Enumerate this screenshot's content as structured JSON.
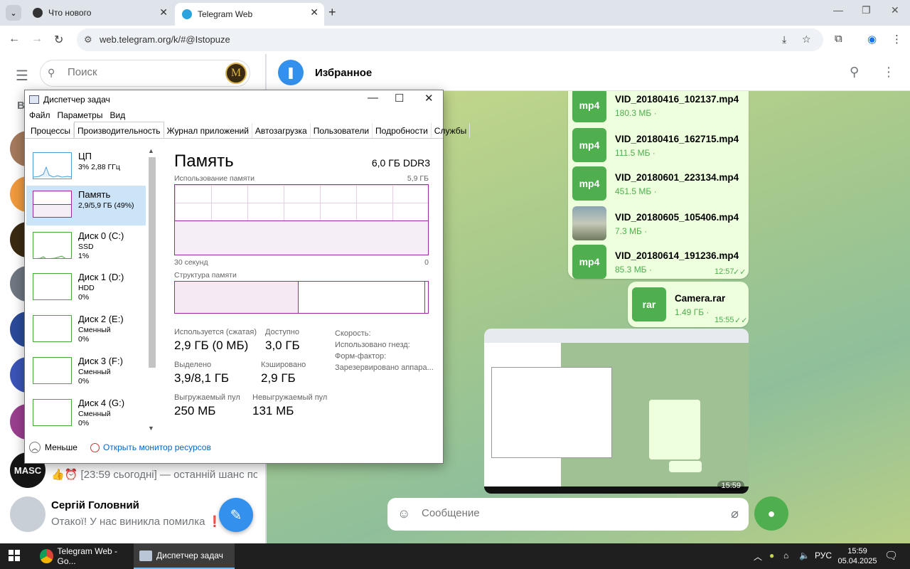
{
  "browser": {
    "tabs": [
      {
        "title": "Что нового"
      },
      {
        "title": "Telegram Web"
      }
    ],
    "url": "web.telegram.org/k/#@Istopuze"
  },
  "telegram": {
    "search_placeholder": "Поиск",
    "folder_letter": "В",
    "chats": [
      {
        "avatar": "MASC",
        "name": "",
        "last": "👍⏰ [23:59 сьогодні] — останній шанс по..."
      },
      {
        "avatar": "",
        "name": "Сергій Головний",
        "last": "Отакої! У нас виникла помилка ❗ В..."
      }
    ],
    "header_title": "Избранное",
    "files": [
      {
        "ext": "mp4",
        "name": "VID_20180416_102137.mp4",
        "size": "180.3 МБ ·"
      },
      {
        "ext": "mp4",
        "name": "VID_20180416_162715.mp4",
        "size": "111.5 МБ ·"
      },
      {
        "ext": "mp4",
        "name": "VID_20180601_223134.mp4",
        "size": "451.5 МБ ·"
      },
      {
        "ext": "",
        "name": "VID_20180605_105406.mp4",
        "size": "7.3 МБ ·"
      },
      {
        "ext": "mp4",
        "name": "VID_20180614_191236.mp4",
        "size": "85.3 МБ ·"
      }
    ],
    "files_time": "12:57",
    "rar": {
      "ext": "rar",
      "name": "Camera.rar",
      "size": "1.49 ГБ ·",
      "time": "15:55"
    },
    "screenshot_time": "15:59",
    "composer_placeholder": "Сообщение"
  },
  "taskmgr": {
    "title": "Диспетчер задач",
    "menu": [
      "Файл",
      "Параметры",
      "Вид"
    ],
    "tabs": [
      "Процессы",
      "Производительность",
      "Журнал приложений",
      "Автозагрузка",
      "Пользователи",
      "Подробности",
      "Службы"
    ],
    "resources": [
      {
        "name": "ЦП",
        "sub": "3% 2,88 ГГц",
        "sub2": ""
      },
      {
        "name": "Память",
        "sub": "2,9/5,9 ГБ (49%)",
        "sub2": ""
      },
      {
        "name": "Диск 0 (C:)",
        "sub": "SSD",
        "sub2": "1%"
      },
      {
        "name": "Диск 1 (D:)",
        "sub": "HDD",
        "sub2": "0%"
      },
      {
        "name": "Диск 2 (E:)",
        "sub": "Сменный",
        "sub2": "0%"
      },
      {
        "name": "Диск 3 (F:)",
        "sub": "Сменный",
        "sub2": "0%"
      },
      {
        "name": "Диск 4 (G:)",
        "sub": "Сменный",
        "sub2": "0%"
      }
    ],
    "memory": {
      "heading": "Память",
      "capacity": "6,0 ГБ DDR3",
      "usage_label": "Использование памяти",
      "usage_max": "5,9 ГБ",
      "time_label": "30 секунд",
      "zero": "0",
      "usage_fraction": 0.49,
      "structure_label": "Структура памяти",
      "used_fraction": 0.49,
      "standby_fraction": 0.99,
      "stats": [
        {
          "label": "Используется (сжатая)",
          "value": "2,9 ГБ (0 МБ)"
        },
        {
          "label": "Доступно",
          "value": "3,0 ГБ"
        },
        {
          "label": "Выделено",
          "value": "3,9/8,1 ГБ"
        },
        {
          "label": "Кэшировано",
          "value": "2,9 ГБ"
        },
        {
          "label": "Выгружаемый пул",
          "value": "250 МБ"
        },
        {
          "label": "Невыгружаемый пул",
          "value": "131 МБ"
        }
      ],
      "props": [
        "Скорость:",
        "Использовано гнезд:",
        "Форм-фактор:",
        "Зарезервировано аппара..."
      ]
    },
    "less": "Меньше",
    "monitor_link": "Открыть монитор ресурсов"
  },
  "taskbar": {
    "items": [
      "Telegram Web - Go...",
      "Диспетчер задач"
    ],
    "lang": "РУС",
    "time": "15:59",
    "date": "05.04.2025"
  },
  "colors": {
    "telegram_blue": "#3390ec",
    "telegram_green": "#4fae4e",
    "memory_purple": "#9c2a9c"
  }
}
